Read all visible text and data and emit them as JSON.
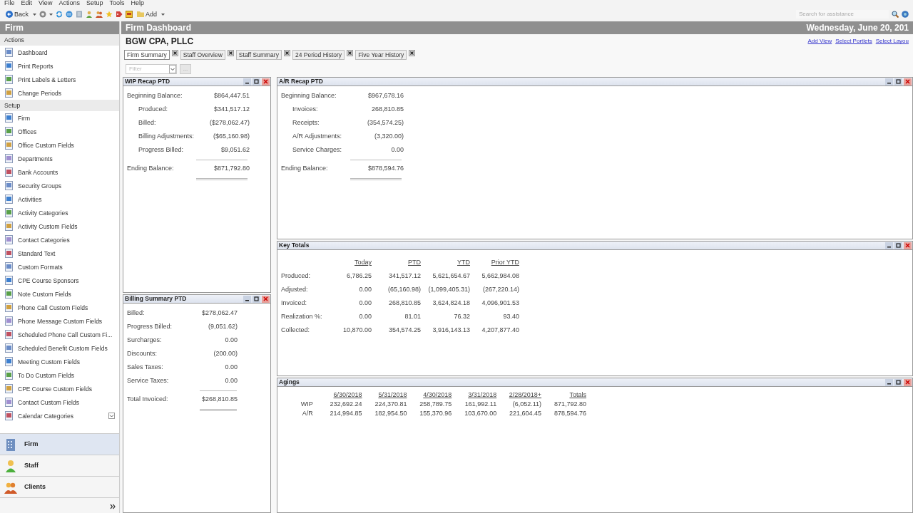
{
  "menu": [
    "File",
    "Edit",
    "View",
    "Actions",
    "Setup",
    "Tools",
    "Help"
  ],
  "toolbar": {
    "back": "Back",
    "add": "Add",
    "search_placeholder": "Search for assistance"
  },
  "sidebar": {
    "title": "Firm",
    "groups": [
      {
        "label": "Actions",
        "items": [
          "Dashboard",
          "Print Reports",
          "Print Labels & Letters",
          "Change Periods"
        ]
      },
      {
        "label": "Setup",
        "items": [
          "Firm",
          "Offices",
          "Office Custom Fields",
          "Departments",
          "Bank Accounts",
          "Security Groups",
          "Activities",
          "Activity Categories",
          "Activity Custom Fields",
          "Contact Categories",
          "Standard Text",
          "Custom Formats",
          "CPE Course Sponsors",
          "Note Custom Fields",
          "Phone Call Custom Fields",
          "Phone Message Custom Fields",
          "Scheduled Phone Call Custom Fi...",
          "Scheduled Benefit Custom Fields",
          "Meeting Custom Fields",
          "To Do Custom Fields",
          "CPE Course Custom Fields",
          "Contact Custom Fields",
          "Calendar Categories"
        ]
      }
    ],
    "nav": [
      {
        "label": "Firm",
        "kind": "building",
        "selected": true
      },
      {
        "label": "Staff",
        "kind": "person",
        "selected": false
      },
      {
        "label": "Clients",
        "kind": "people",
        "selected": false
      }
    ]
  },
  "header": {
    "title": "Firm Dashboard",
    "date": "Wednesday, June 20, 201",
    "links": [
      "Add View",
      "Select Portlets",
      "Select Layou"
    ]
  },
  "company": "BGW CPA, PLLC",
  "tabs": [
    {
      "label": "Firm Summary",
      "selected": true
    },
    {
      "label": "Staff Overview",
      "selected": false
    },
    {
      "label": "Staff Summary",
      "selected": false
    },
    {
      "label": "24 Period History",
      "selected": false
    },
    {
      "label": "Five Year History",
      "selected": false
    }
  ],
  "filter": {
    "placeholder": "Filter",
    "more": "..."
  },
  "wip_recap": {
    "title": "WIP Recap PTD",
    "rows": [
      {
        "kind": "main",
        "label": "Beginning Balance:",
        "value": "$864,447.51"
      },
      {
        "kind": "sub",
        "label": "Produced:",
        "value": "$341,517.12"
      },
      {
        "kind": "sub",
        "label": "Billed:",
        "value": "($278,062.47)"
      },
      {
        "kind": "sub",
        "label": "Billing Adjustments:",
        "value": "($65,160.98)"
      },
      {
        "kind": "sub",
        "label": "Progress Billed:",
        "value": "$9,051.62"
      },
      {
        "kind": "total",
        "label": "Ending Balance:",
        "value": "$871,792.80"
      }
    ]
  },
  "ar_recap": {
    "title": "A/R Recap PTD",
    "rows": [
      {
        "kind": "main",
        "label": "Beginning Balance:",
        "value": "$967,678.16"
      },
      {
        "kind": "sub",
        "label": "Invoices:",
        "value": "268,810.85"
      },
      {
        "kind": "sub",
        "label": "Receipts:",
        "value": "(354,574.25)"
      },
      {
        "kind": "sub",
        "label": "A/R Adjustments:",
        "value": "(3,320.00)"
      },
      {
        "kind": "sub",
        "label": "Service Charges:",
        "value": "0.00"
      },
      {
        "kind": "total",
        "label": "Ending Balance:",
        "value": "$878,594.76"
      }
    ]
  },
  "billing_summary": {
    "title": "Billing Summary PTD",
    "rows": [
      {
        "kind": "main",
        "label": "Billed:",
        "value": "$278,062.47"
      },
      {
        "kind": "main",
        "label": "Progress Billed:",
        "value": "(9,051.62)"
      },
      {
        "kind": "main",
        "label": "Surcharges:",
        "value": "0.00"
      },
      {
        "kind": "main",
        "label": "Discounts:",
        "value": "(200.00)"
      },
      {
        "kind": "main",
        "label": "Sales Taxes:",
        "value": "0.00"
      },
      {
        "kind": "main",
        "label": "Service Taxes:",
        "value": "0.00"
      },
      {
        "kind": "total",
        "label": "Total Invoiced:",
        "value": "$268,810.85"
      }
    ]
  },
  "key_totals": {
    "title": "Key Totals",
    "columns": [
      "Today",
      "PTD",
      "YTD",
      "Prior YTD"
    ],
    "rows": [
      {
        "label": "Produced:",
        "values": [
          "6,786.25",
          "341,517.12",
          "5,621,654.67",
          "5,662,984.08"
        ]
      },
      {
        "label": "Adjusted:",
        "values": [
          "0.00",
          "(65,160.98)",
          "(1,099,405.31)",
          "(267,220.14)"
        ]
      },
      {
        "label": "Invoiced:",
        "values": [
          "0.00",
          "268,810.85",
          "3,624,824.18",
          "4,096,901.53"
        ]
      },
      {
        "label": "Realization %:",
        "values": [
          "0.00",
          "81.01",
          "76.32",
          "93.40"
        ]
      },
      {
        "label": "Collected:",
        "values": [
          "10,870.00",
          "354,574.25",
          "3,916,143.13",
          "4,207,877.40"
        ]
      }
    ]
  },
  "agings": {
    "title": "Agings",
    "columns": [
      "6/30/2018",
      "5/31/2018",
      "4/30/2018",
      "3/31/2018",
      "2/28/2018+",
      "Totals"
    ],
    "rows": [
      {
        "label": "WIP",
        "values": [
          "232,692.24",
          "224,370.81",
          "258,789.75",
          "161,992.11",
          "(6,052.11)",
          "871,792.80"
        ]
      },
      {
        "label": "A/R",
        "values": [
          "214,994.85",
          "182,954.50",
          "155,370.96",
          "103,670.00",
          "221,604.45",
          "878,594.76"
        ]
      }
    ]
  }
}
